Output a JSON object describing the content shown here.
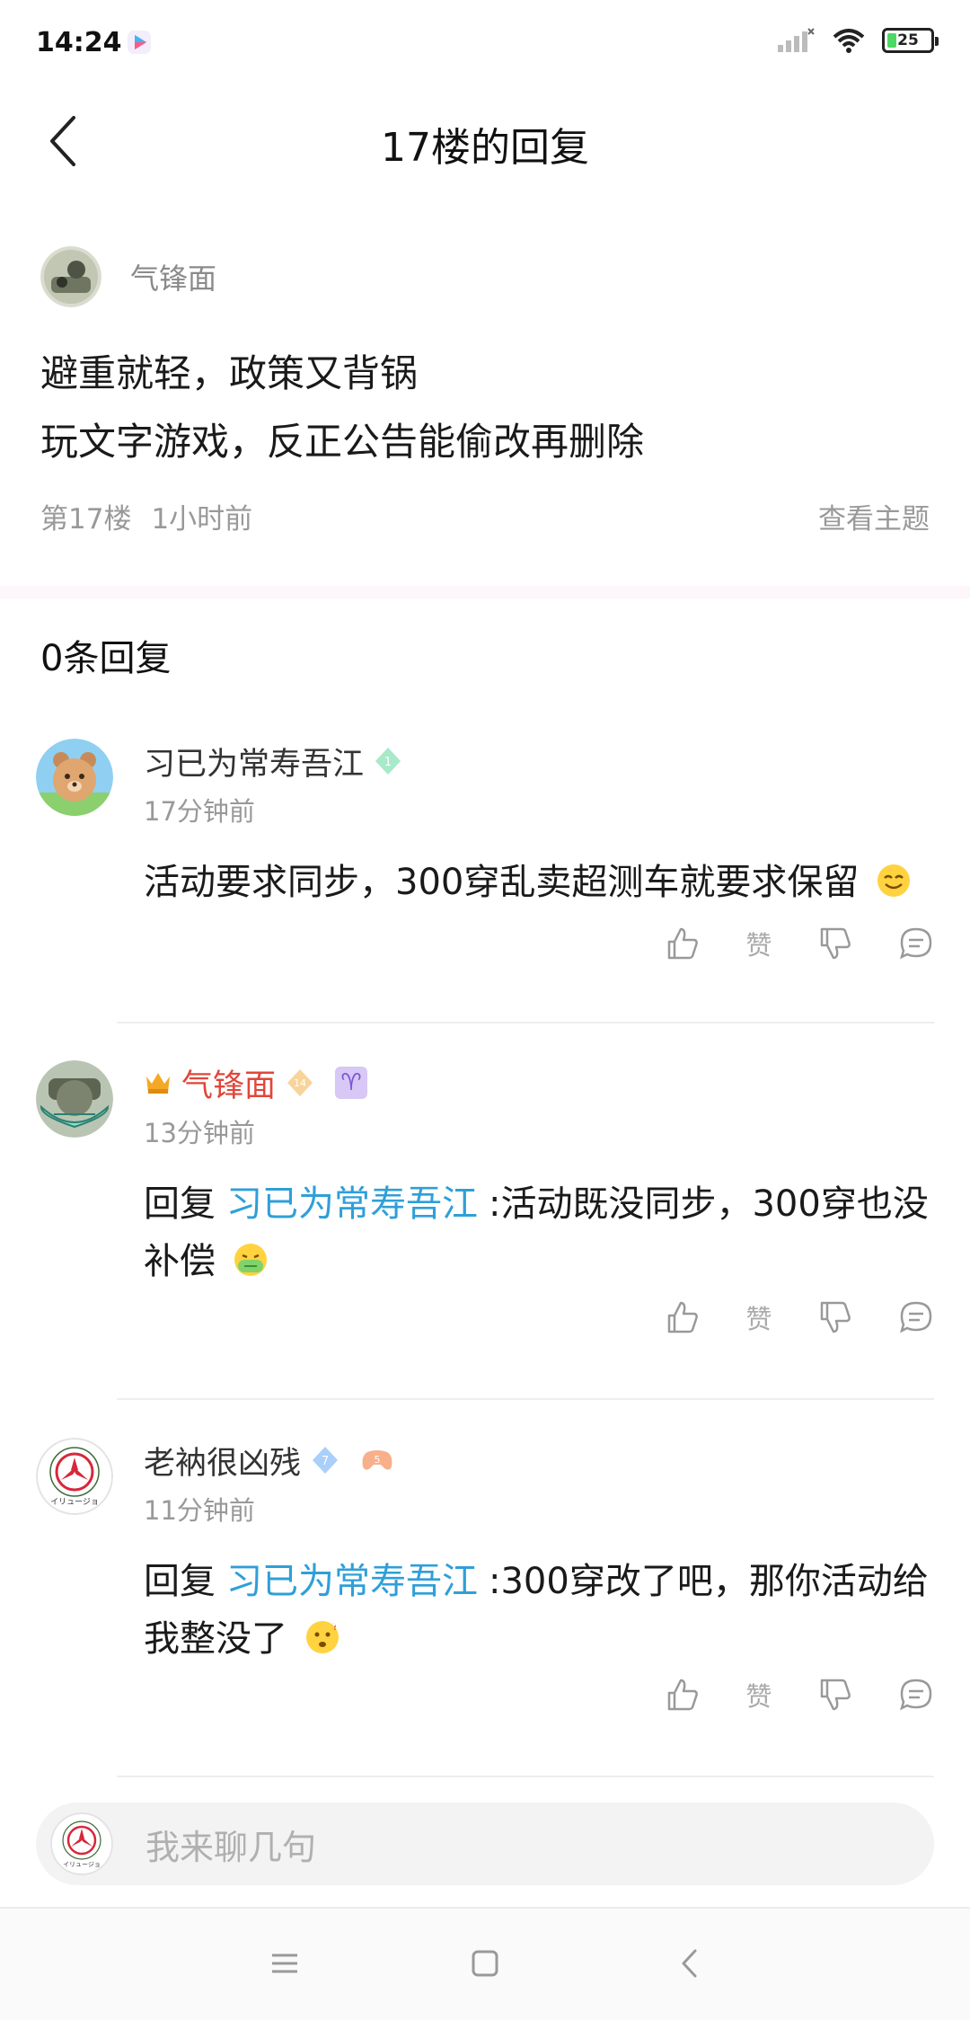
{
  "status_bar": {
    "time": "14:24",
    "battery": "25",
    "icons": [
      "app-play-icon",
      "signal-icon",
      "wifi-icon",
      "battery-icon"
    ]
  },
  "header": {
    "title": "17楼的回复",
    "back_icon": "chevron-left-icon"
  },
  "original_post": {
    "author": "气锋面",
    "lines": [
      "避重就轻，政策又背锅",
      "玩文字游戏，反正公告能偷改再删除"
    ],
    "floor": "第17楼",
    "time": "1小时前",
    "view_topic": "查看主题"
  },
  "replies_header": {
    "count_label": "0条回复"
  },
  "replies": [
    {
      "author": "习已为常寿吾江",
      "level_badge": "1",
      "time": "17分钟前",
      "text": "活动要求同步，300穿乱卖超测车就要求保留",
      "like_label": "赞"
    },
    {
      "author": "气锋面",
      "level_badge": "14",
      "zodiac": "♈",
      "time": "13分钟前",
      "reply_prefix": "回复",
      "mention": "习已为常寿吾江",
      "text": ":活动既没同步，300穿也没补偿",
      "like_label": "赞"
    },
    {
      "author": "老衲很凶残",
      "level_badge": "7",
      "extra_badge": "5",
      "time": "11分钟前",
      "reply_prefix": "回复",
      "mention": "习已为常寿吾江",
      "text": ":300穿改了吧，那你活动给我整没了",
      "like_label": "赞"
    }
  ],
  "input_bar": {
    "placeholder": "我来聊几句"
  },
  "colors": {
    "mention": "#2f9fd8",
    "vip_name": "#e0463a",
    "muted": "#999999"
  }
}
